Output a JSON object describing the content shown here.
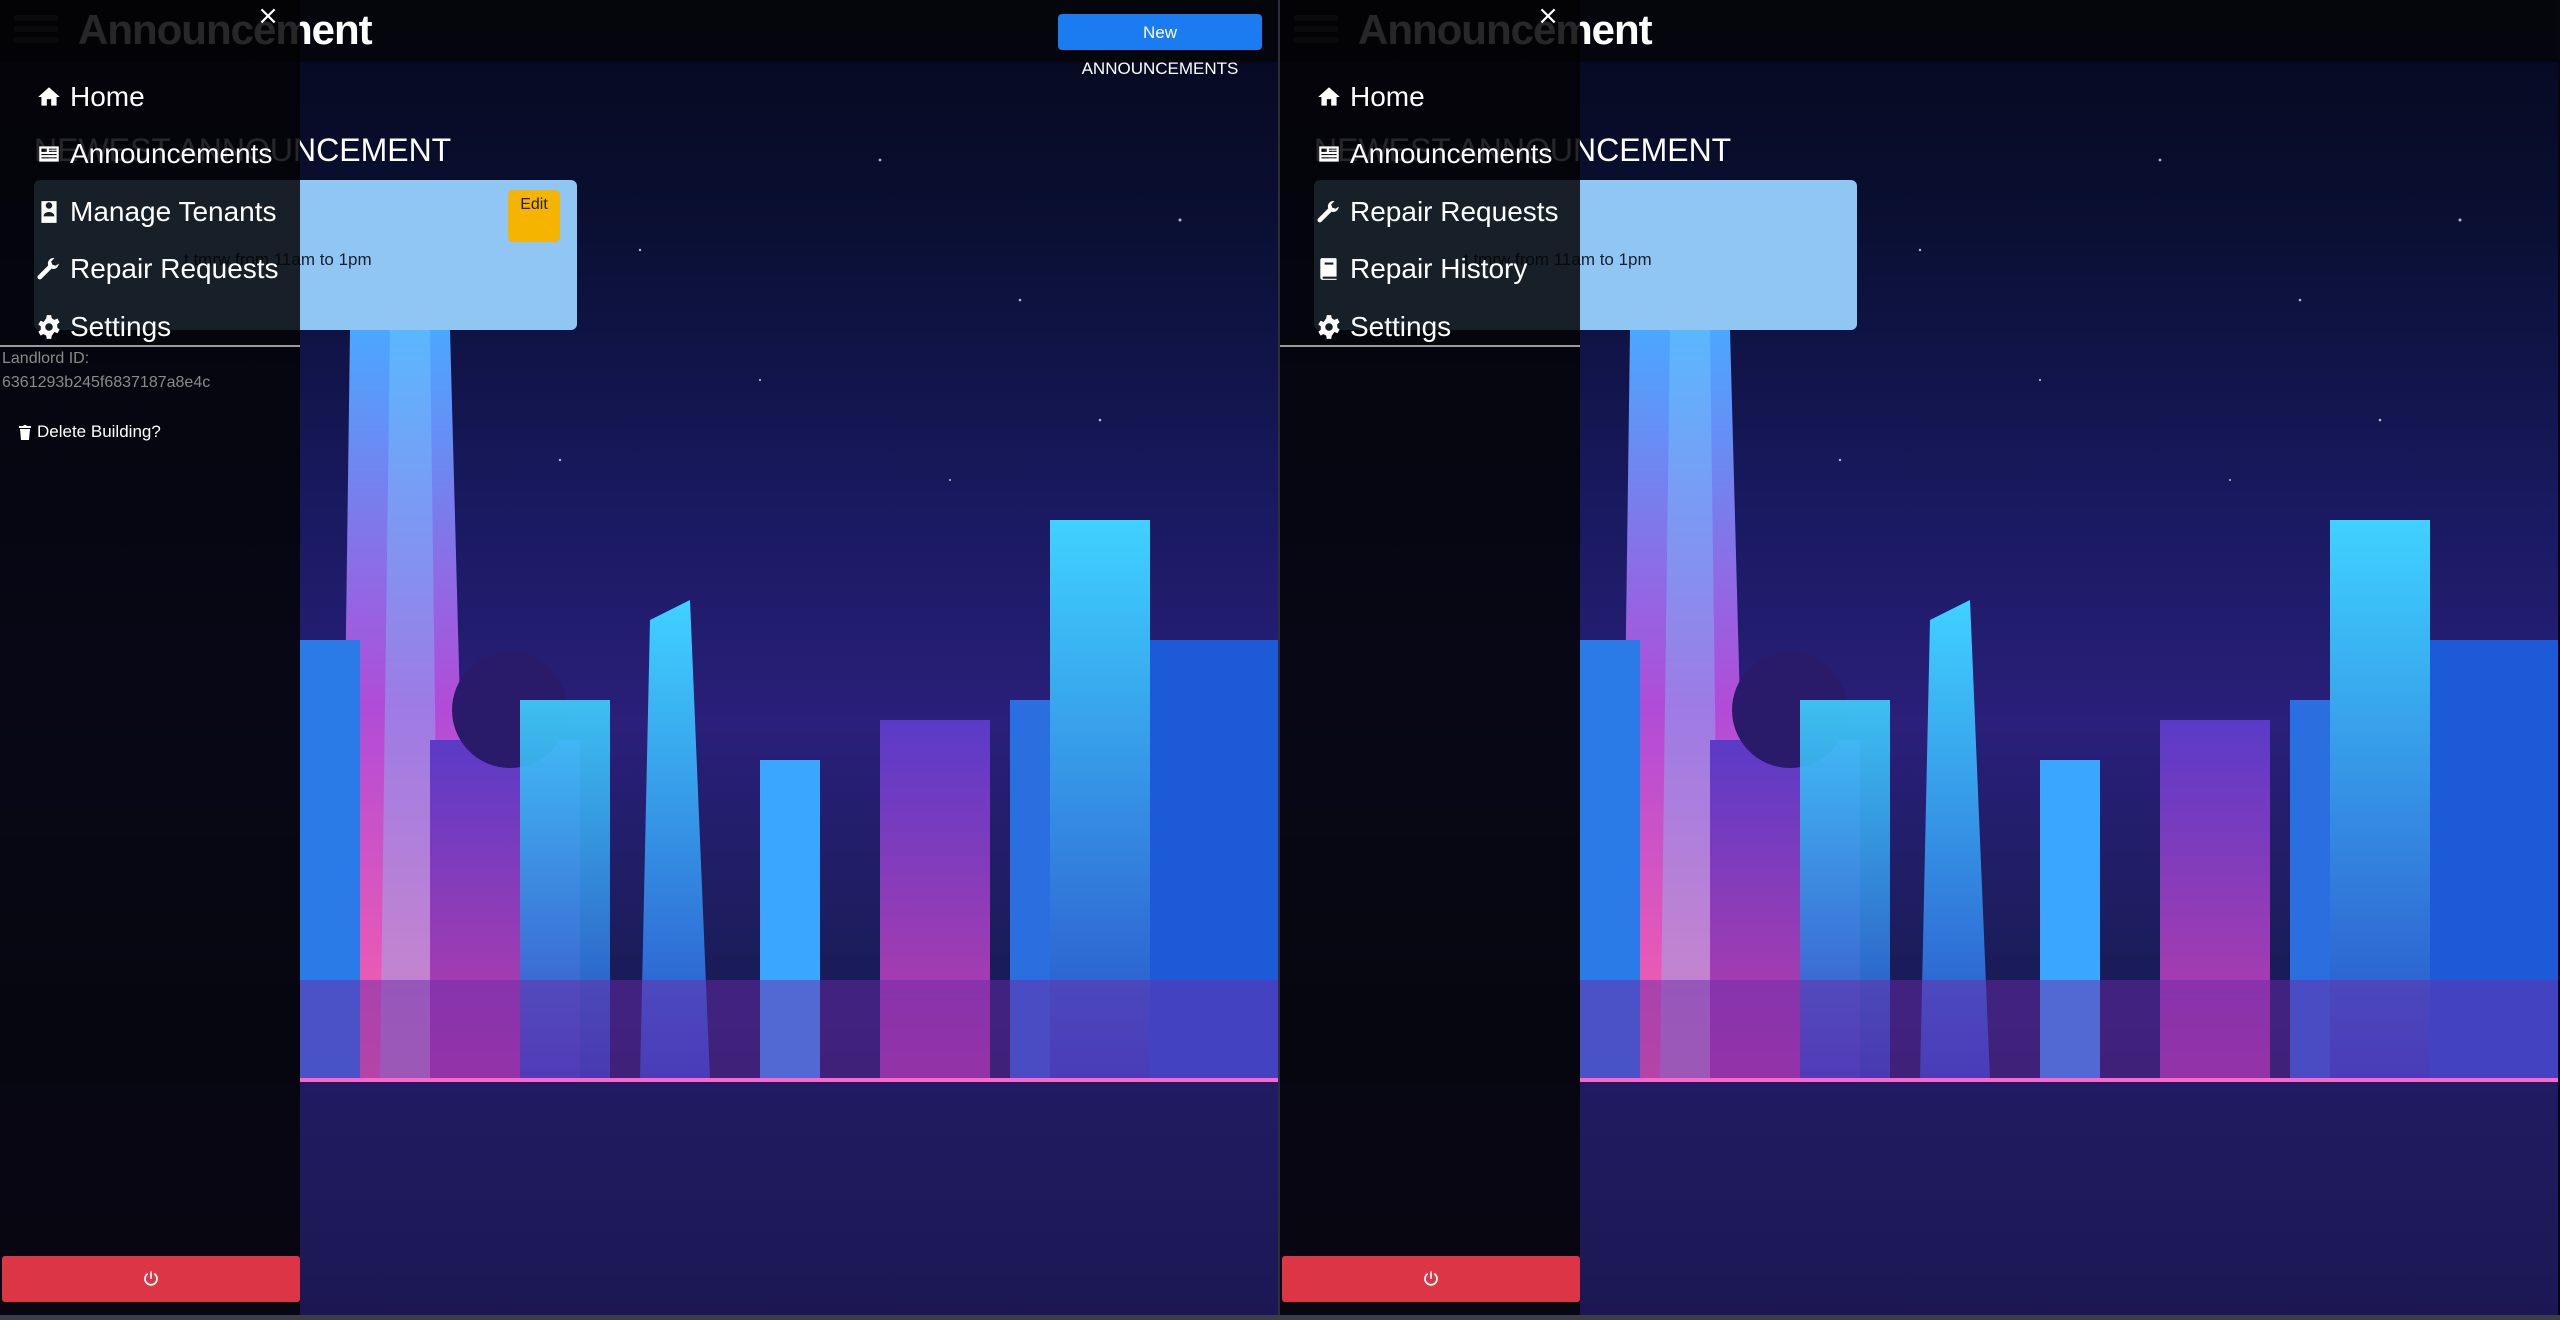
{
  "panels": {
    "left": {
      "page_heading": "Announcement",
      "new_button": "New ANNOUNCEMENTS",
      "section_heading": "NEWEST ANNOUNCEMENT",
      "card": {
        "edit_label": "Edit",
        "text": "t tmrw from 11am to 1pm"
      },
      "menu": {
        "close_label": "×",
        "items": [
          {
            "label": "Home",
            "icon": "home-icon"
          },
          {
            "label": "Announcements",
            "icon": "newspaper-icon"
          },
          {
            "label": "Manage Tenants",
            "icon": "address-book-icon"
          },
          {
            "label": "Repair Requests",
            "icon": "wrench-icon"
          },
          {
            "label": "Settings",
            "icon": "gear-icon"
          }
        ],
        "landlord_label": "Landlord ID:",
        "landlord_id": "6361293b245f6837187a8e4c",
        "delete_building": "Delete Building?",
        "logout_icon": "power-icon"
      }
    },
    "right": {
      "page_heading": "Announcement",
      "section_heading": "NEWEST ANNOUNCEMENT",
      "card": {
        "text": "t tmrw from 11am to 1pm"
      },
      "menu": {
        "close_label": "×",
        "items": [
          {
            "label": "Home",
            "icon": "home-icon"
          },
          {
            "label": "Announcements",
            "icon": "newspaper-icon"
          },
          {
            "label": "Repair Requests",
            "icon": "wrench-icon"
          },
          {
            "label": "Repair History",
            "icon": "book-icon"
          },
          {
            "label": "Settings",
            "icon": "gear-icon"
          }
        ],
        "logout_icon": "power-icon"
      }
    }
  },
  "colors": {
    "new_button": "#1a7cf0",
    "card_bg": "#8fc6f4",
    "edit_button": "#f5b400",
    "logout_button": "#dc3545"
  }
}
